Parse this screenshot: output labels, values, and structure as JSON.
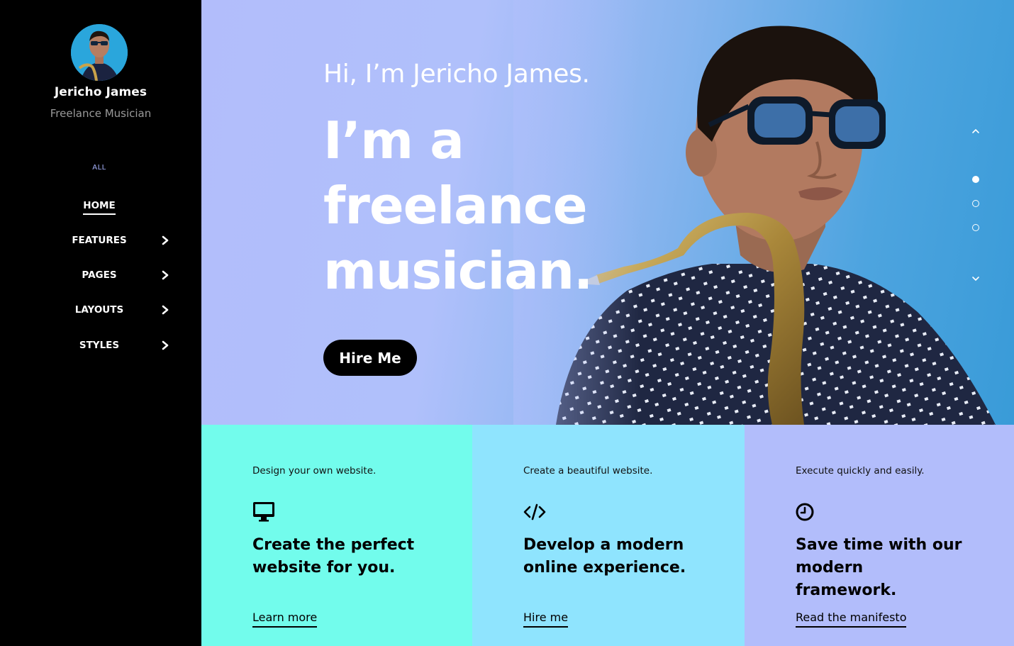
{
  "profile": {
    "name": "Jericho James",
    "role": "Freelance Musician"
  },
  "sidebar": {
    "filter_label": "ALL",
    "items": [
      {
        "label": "HOME",
        "active": true
      },
      {
        "label": "FEATURES",
        "has_submenu": true
      },
      {
        "label": "PAGES",
        "has_submenu": true
      },
      {
        "label": "LAYOUTS",
        "has_submenu": true
      },
      {
        "label": "STYLES",
        "has_submenu": true
      }
    ]
  },
  "hero": {
    "greeting": "Hi, I’m Jericho James.",
    "headline": "I’m a freelance musician.",
    "cta_label": "Hire Me",
    "slides": {
      "count": 3,
      "active_index": 0
    }
  },
  "cards": [
    {
      "kicker": "Design your own website.",
      "icon": "desktop-icon",
      "title": "Create the perfect website for you.",
      "link": "Learn more",
      "color": "#72fcec"
    },
    {
      "kicker": "Create a beautiful website.",
      "icon": "code-icon",
      "title": "Develop a modern online experience.",
      "link": "Hire me",
      "color": "#8fe4fe"
    },
    {
      "kicker": "Execute quickly and easily.",
      "icon": "clock-icon",
      "title": "Save time with our modern framework.",
      "link": "Read the manifesto",
      "color": "#b2bdfb"
    }
  ],
  "colors": {
    "sidebar_bg": "#000000",
    "accent": "#a8b4ff",
    "hero_left": "#b2bdfb",
    "hero_right": "#399bd8"
  }
}
